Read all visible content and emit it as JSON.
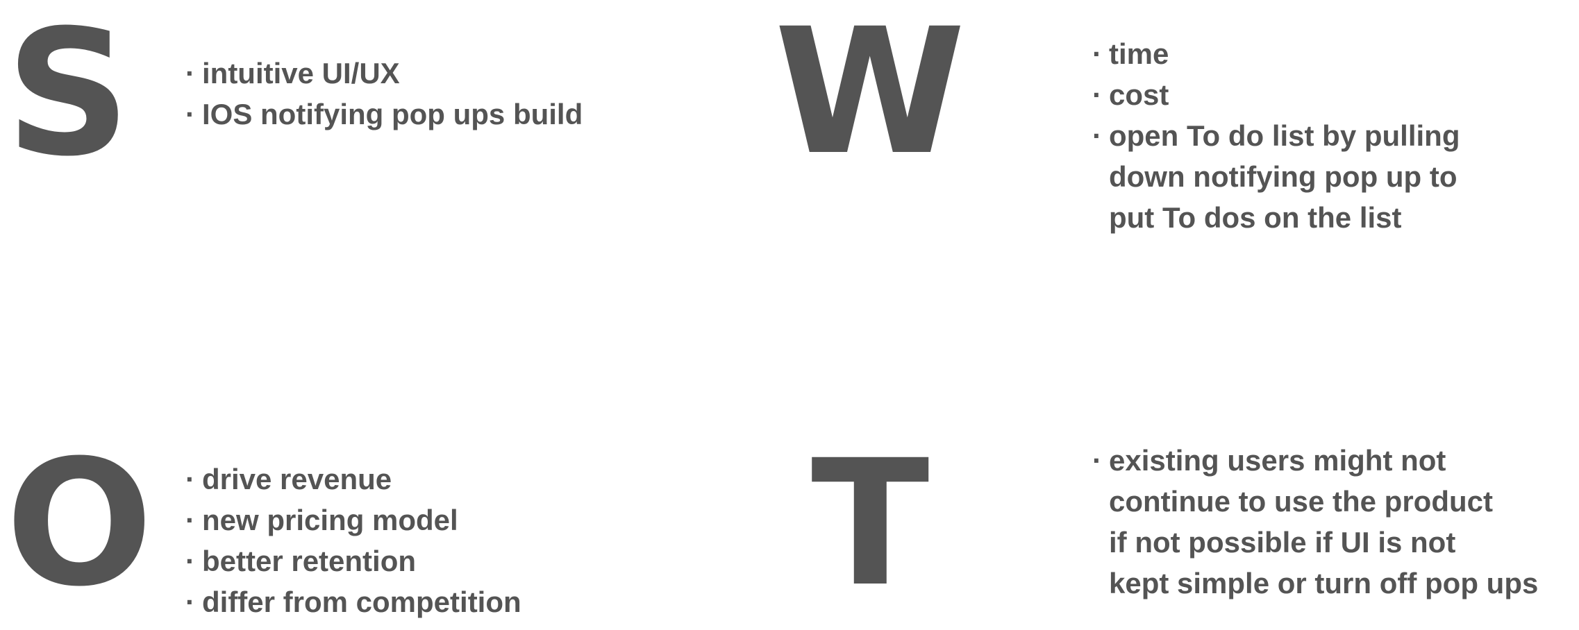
{
  "text_color": "#545454",
  "background": "#ffffff",
  "strengths": {
    "letter": "S",
    "items": [
      "intuitive UI/UX",
      "IOS notifying pop ups build"
    ]
  },
  "weaknesses": {
    "letter": "W",
    "items": [
      "time",
      "cost",
      "open To do list by pulling",
      "down notifying  pop up to",
      "put To dos on the list"
    ]
  },
  "opportunities": {
    "letter": "O",
    "items": [
      "drive revenue",
      "new pricing model",
      "better retention",
      "differ from competition"
    ]
  },
  "threats": {
    "letter": "T",
    "items": [
      "existing users might not",
      "continue to use the product",
      "if not possible if UI is not",
      "kept simple or  turn off pop ups"
    ]
  },
  "bullet": "·"
}
